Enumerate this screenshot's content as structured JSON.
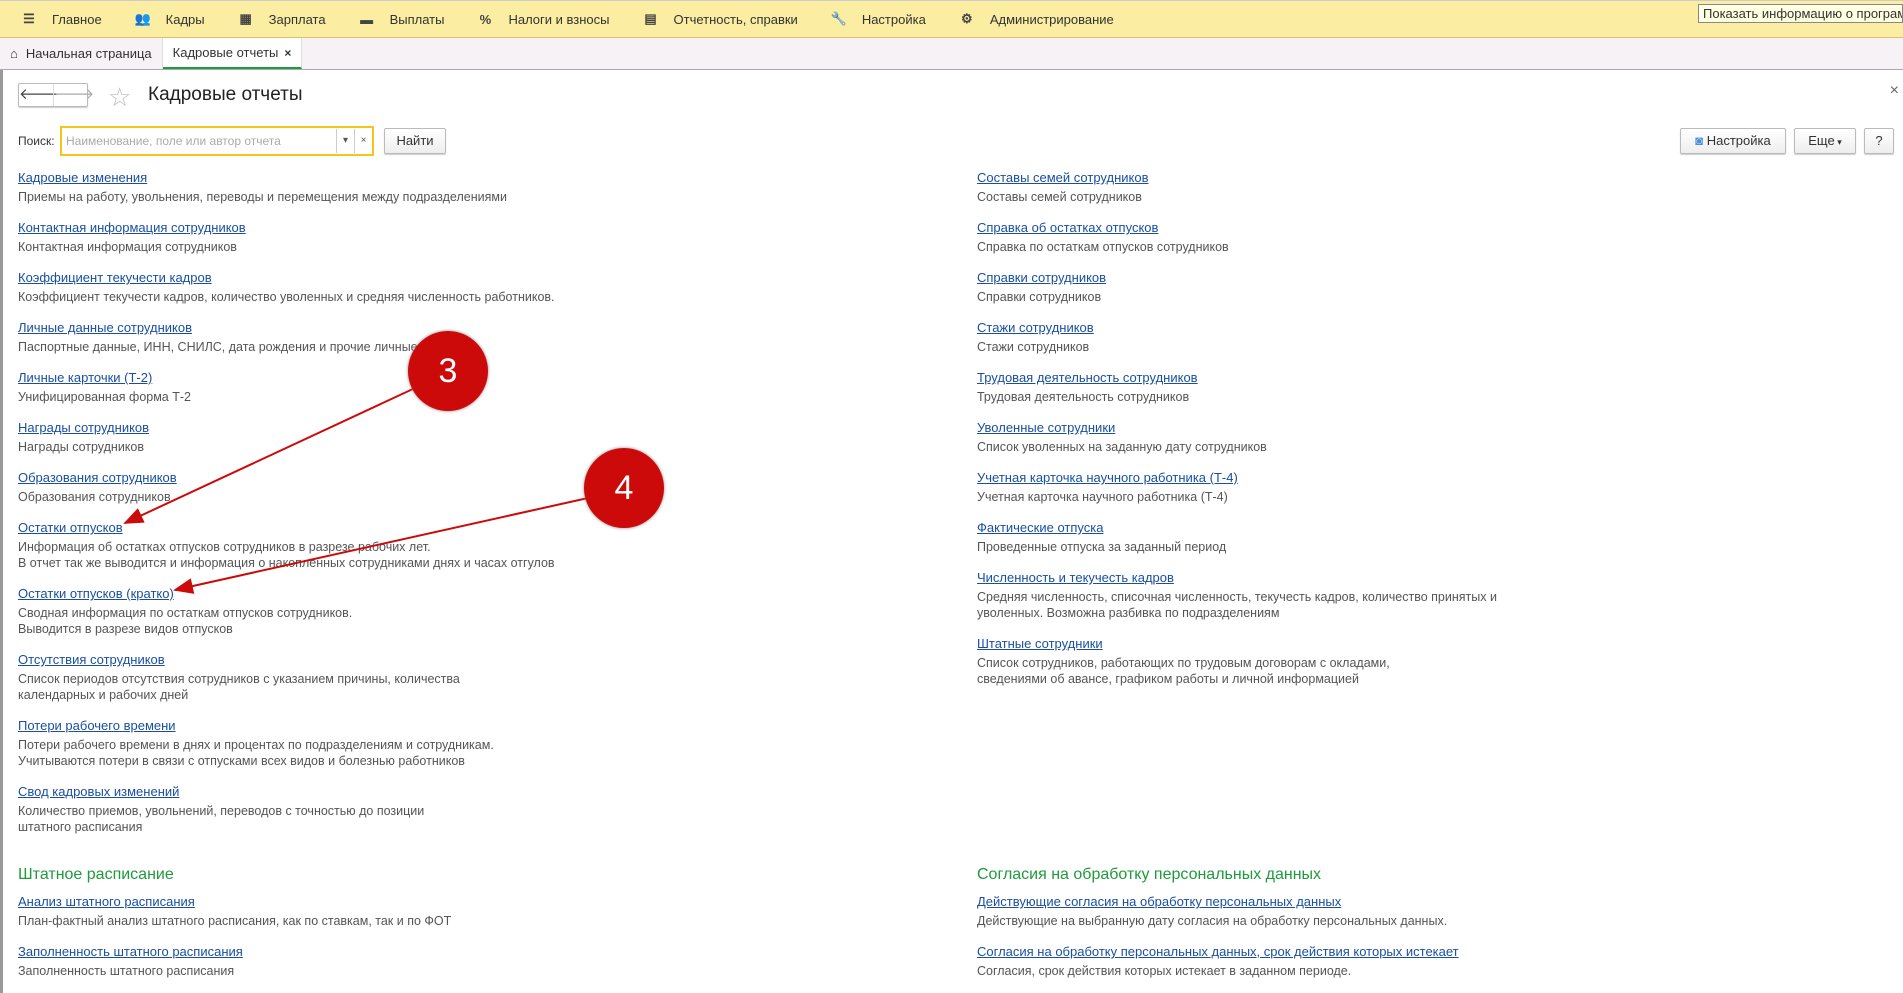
{
  "topbar": {
    "items": [
      {
        "icon": "menu-icon",
        "glyph": "☰",
        "label": "Главное"
      },
      {
        "icon": "users-icon",
        "glyph": "👥",
        "label": "Кадры"
      },
      {
        "icon": "calculator-icon",
        "glyph": "▦",
        "label": "Зарплата"
      },
      {
        "icon": "wallet-icon",
        "glyph": "▬",
        "label": "Выплаты"
      },
      {
        "icon": "percent-icon",
        "glyph": "%",
        "label": "Налоги и взносы"
      },
      {
        "icon": "documents-icon",
        "glyph": "▤",
        "label": "Отчетность, справки"
      },
      {
        "icon": "wrench-icon",
        "glyph": "🔧",
        "label": "Настройка"
      },
      {
        "icon": "gear-icon",
        "glyph": "⚙",
        "label": "Администрирование"
      }
    ],
    "tooltip": "Показать информацию о программе"
  },
  "tabs": {
    "home": "Начальная страница",
    "active": "Кадровые отчеты",
    "close": "×"
  },
  "page": {
    "title": "Кадровые отчеты",
    "close": "×"
  },
  "search": {
    "label": "Поиск:",
    "placeholder": "Наименование, поле или автор отчета",
    "find": "Найти"
  },
  "toolbar": {
    "settings": "Настройка",
    "more": "Еще",
    "help": "?"
  },
  "left": [
    {
      "link": "Кадровые изменения",
      "desc": [
        "Приемы на работу, увольнения, переводы и перемещения между подразделениями"
      ]
    },
    {
      "link": "Контактная информация сотрудников",
      "desc": [
        "Контактная информация сотрудников"
      ]
    },
    {
      "link": "Коэффициент текучести кадров",
      "desc": [
        "Коэффициент текучести кадров, количество уволенных и средняя численность работников."
      ]
    },
    {
      "link": "Личные данные сотрудников",
      "desc": [
        "Паспортные данные, ИНН, СНИЛС, дата рождения и прочие личные данные"
      ]
    },
    {
      "link": "Личные карточки (Т-2)",
      "desc": [
        "Унифицированная форма Т-2"
      ]
    },
    {
      "link": "Награды сотрудников",
      "desc": [
        "Награды сотрудников"
      ]
    },
    {
      "link": "Образования сотрудников",
      "desc": [
        "Образования сотрудников"
      ]
    },
    {
      "link": "Остатки отпусков",
      "desc": [
        "Информация об остатках отпусков сотрудников в разрезе рабочих лет.",
        "В отчет так же выводится и информация о накопленных сотрудниками днях и часах отгулов"
      ]
    },
    {
      "link": "Остатки отпусков (кратко)",
      "desc": [
        "Сводная информация по остаткам отпусков сотрудников.",
        "Выводится в разрезе видов отпусков"
      ]
    },
    {
      "link": "Отсутствия сотрудников",
      "desc": [
        "Список периодов отсутствия сотрудников с указанием причины, количества",
        "календарных и рабочих дней"
      ]
    },
    {
      "link": "Потери рабочего времени",
      "desc": [
        "Потери рабочего времени в днях и процентах по подразделениям и сотрудникам.",
        "Учитываются потери в связи с отпусками всех видов и болезнью работников"
      ]
    },
    {
      "link": "Свод кадровых изменений",
      "desc": [
        "Количество приемов, увольнений, переводов с точностью до позиции",
        "штатного расписания"
      ]
    }
  ],
  "right": [
    {
      "link": "Составы семей сотрудников",
      "desc": [
        "Составы семей сотрудников"
      ]
    },
    {
      "link": "Справка об остатках отпусков",
      "desc": [
        "Справка по остаткам отпусков сотрудников"
      ]
    },
    {
      "link": "Справки сотрудников",
      "desc": [
        "Справки сотрудников"
      ]
    },
    {
      "link": "Стажи сотрудников",
      "desc": [
        "Стажи сотрудников"
      ]
    },
    {
      "link": "Трудовая деятельность сотрудников",
      "desc": [
        "Трудовая деятельность сотрудников"
      ]
    },
    {
      "link": "Уволенные сотрудники",
      "desc": [
        "Список уволенных на заданную дату сотрудников"
      ]
    },
    {
      "link": "Учетная карточка научного работника (Т-4)",
      "desc": [
        "Учетная карточка научного работника (Т-4)"
      ]
    },
    {
      "link": "Фактические отпуска",
      "desc": [
        "Проведенные отпуска за заданный период"
      ]
    },
    {
      "link": "Численность и текучесть кадров",
      "desc": [
        "Средняя численность, списочная численность, текучесть кадров, количество принятых и",
        "уволенных. Возможна разбивка по подразделениям"
      ]
    },
    {
      "link": "Штатные сотрудники",
      "desc": [
        "Список сотрудников, работающих по трудовым договорам с окладами,",
        "сведениями об авансе, графиком работы и личной информацией"
      ]
    }
  ],
  "sections": [
    {
      "title": "Штатное расписание",
      "items": [
        {
          "link": "Анализ штатного расписания",
          "desc": [
            "План-фактный анализ штатного расписания, как по ставкам, так и по ФОТ"
          ]
        },
        {
          "link": "Заполненность штатного расписания",
          "desc": [
            "Заполненность штатного расписания"
          ]
        }
      ]
    },
    {
      "title": "Согласия на обработку персональных данных",
      "items": [
        {
          "link": "Действующие согласия на обработку персональных данных",
          "desc": [
            "Действующие на выбранную дату согласия на обработку персональных данных."
          ]
        },
        {
          "link": "Согласия на обработку персональных данных, срок действия которых истекает",
          "desc": [
            "Согласия, срок действия которых истекает в заданном периоде."
          ]
        }
      ]
    }
  ],
  "annotations": {
    "m3": "3",
    "m4": "4",
    "color": "#cc0a0a"
  }
}
